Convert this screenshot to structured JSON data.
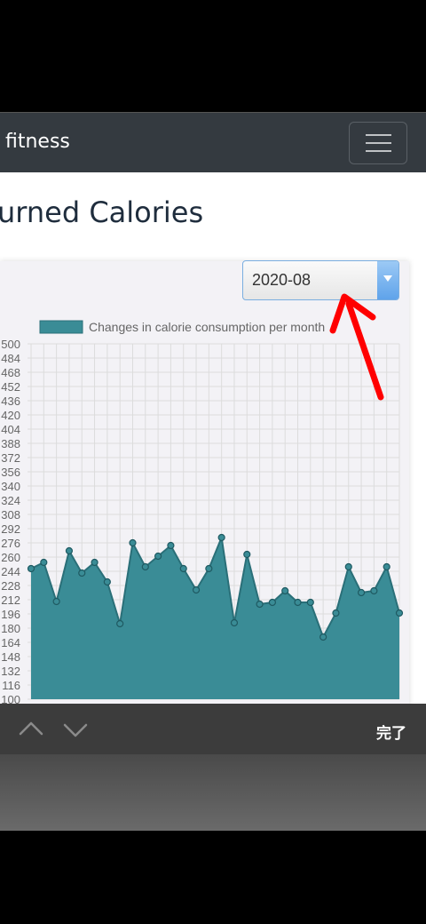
{
  "navbar": {
    "brand": "fitness",
    "menu_icon": "hamburger-menu-icon"
  },
  "page": {
    "title": "urned Calories"
  },
  "month_select": {
    "value": "2020-08"
  },
  "annotation": {
    "arrow_color": "#ff0000"
  },
  "colors": {
    "fill": "#3a8c96",
    "line": "#2a6f78",
    "navbar": "#343a40",
    "toolbar": "#3c3c3c"
  },
  "toolbar": {
    "done_label": "完了",
    "prev_icon": "chevron-up-icon",
    "next_icon": "chevron-down-icon"
  },
  "chart_data": {
    "type": "area",
    "legend": [
      "Changes in calorie consumption per month"
    ],
    "legend_position": "top",
    "grid": true,
    "ylim": [
      100,
      500
    ],
    "y_ticks": [
      "500",
      "484",
      "468",
      "452",
      "436",
      "420",
      "404",
      "388",
      "372",
      "356",
      "340",
      "324",
      "308",
      "292",
      "276",
      "260",
      "244",
      "228",
      "212",
      "196",
      "180",
      "164",
      "148",
      "132",
      "116",
      "100"
    ],
    "series": [
      {
        "name": "Changes in calorie consumption per month",
        "values": [
          247,
          254,
          210,
          267,
          242,
          254,
          232,
          185,
          276,
          249,
          261,
          273,
          247,
          223,
          247,
          282,
          186,
          263,
          207,
          209,
          222,
          209,
          209,
          170,
          197,
          249,
          220,
          222,
          249,
          197
        ]
      }
    ]
  }
}
